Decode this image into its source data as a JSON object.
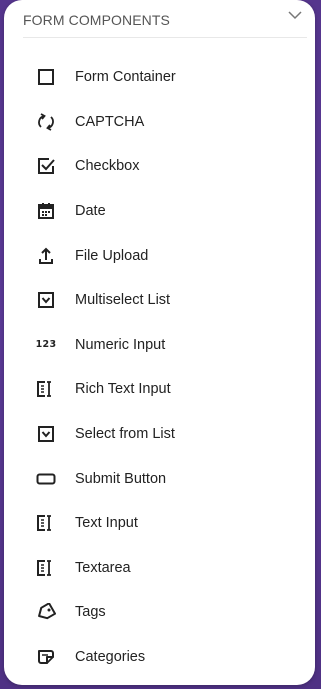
{
  "panel": {
    "title": "FORM COMPONENTS",
    "collapse_icon": "chevron-down-icon"
  },
  "components": [
    {
      "label": "Form Container",
      "icon": "square-outline-icon"
    },
    {
      "label": "CAPTCHA",
      "icon": "refresh-icon"
    },
    {
      "label": "Checkbox",
      "icon": "checkbox-checked-icon"
    },
    {
      "label": "Date",
      "icon": "calendar-icon"
    },
    {
      "label": "File Upload",
      "icon": "upload-icon"
    },
    {
      "label": "Multiselect List",
      "icon": "dropdown-box-icon"
    },
    {
      "label": "Numeric Input",
      "icon": "numeric-123-icon",
      "icon_text": "123"
    },
    {
      "label": "Rich Text Input",
      "icon": "text-field-icon"
    },
    {
      "label": "Select from List",
      "icon": "dropdown-box-icon"
    },
    {
      "label": "Submit Button",
      "icon": "button-outline-icon"
    },
    {
      "label": "Text Input",
      "icon": "text-field-icon"
    },
    {
      "label": "Textarea",
      "icon": "text-field-icon"
    },
    {
      "label": "Tags",
      "icon": "tag-icon"
    },
    {
      "label": "Categories",
      "icon": "category-icon"
    }
  ],
  "colors": {
    "background": "#5a3a92",
    "panel": "#ffffff",
    "text": "#222222",
    "header_text": "#555555"
  }
}
